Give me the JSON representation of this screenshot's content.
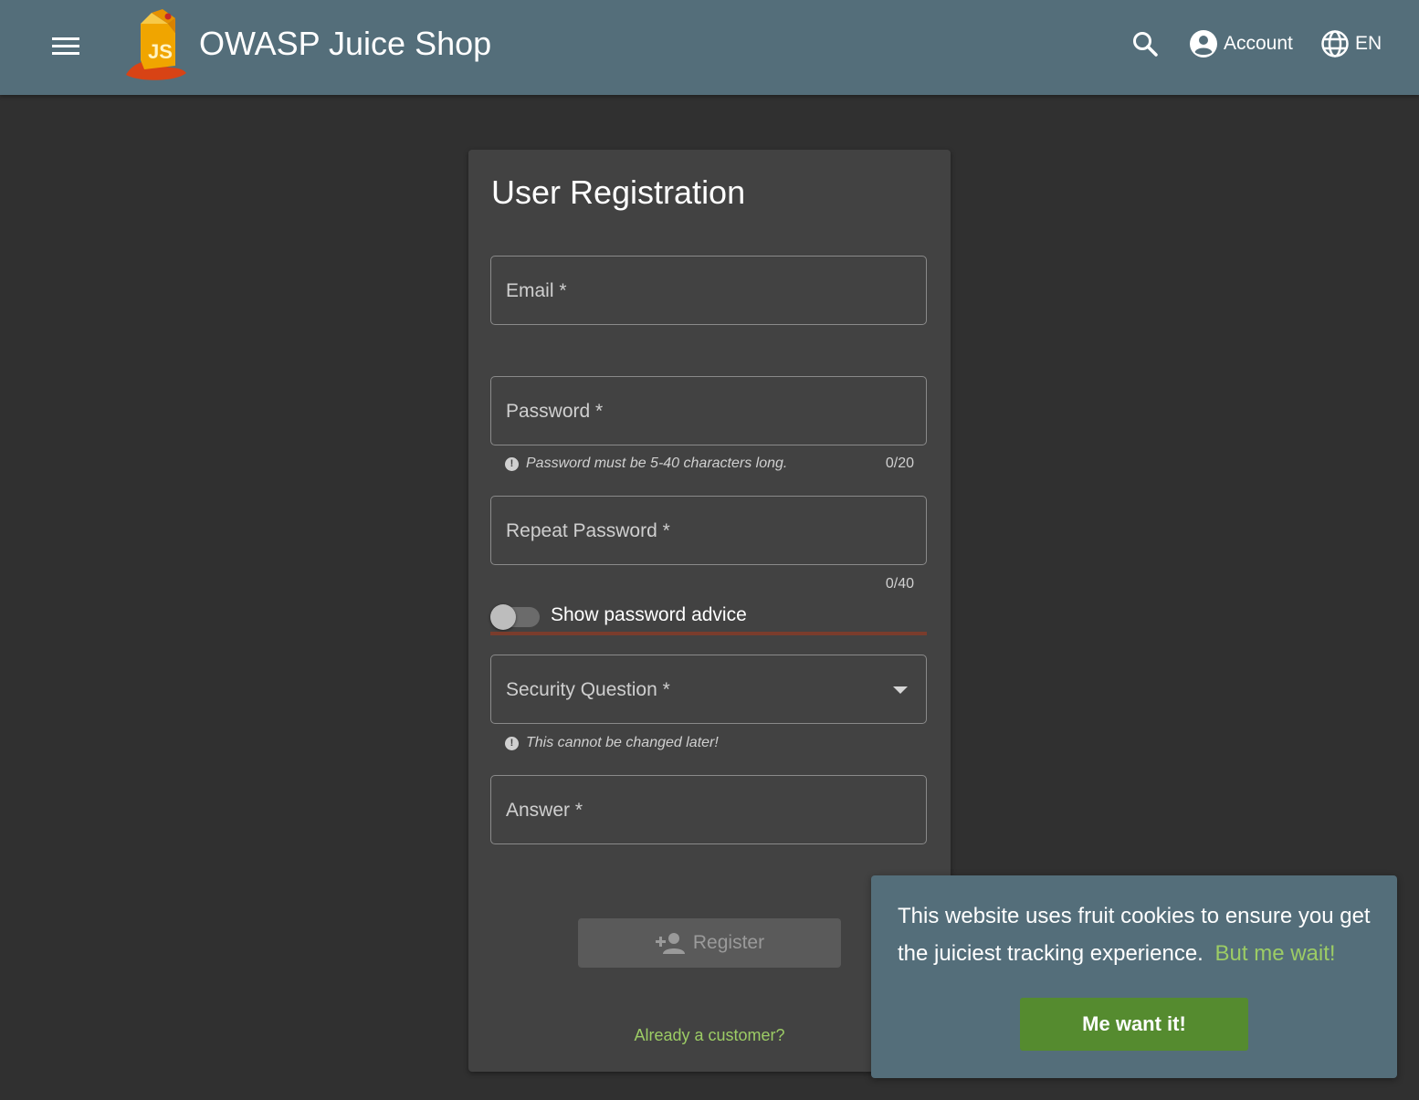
{
  "header": {
    "app_title": "OWASP Juice Shop",
    "account_label": "Account",
    "language_label": "EN",
    "menu_icon": "hamburger-menu-icon",
    "search_icon": "search-icon",
    "account_icon": "account-circle-icon",
    "language_icon": "globe-icon"
  },
  "form": {
    "title": "User Registration",
    "email_label": "Email *",
    "password_label": "Password *",
    "password_hint": "Password must be 5-40 characters long.",
    "password_counter": "0/20",
    "repeat_password_label": "Repeat Password *",
    "repeat_password_counter": "0/40",
    "toggle_label": "Show password advice",
    "toggle_on": false,
    "security_question_label": "Security Question *",
    "security_question_hint": "This cannot be changed later!",
    "answer_label": "Answer *",
    "register_label": "Register",
    "register_icon": "person-add-icon",
    "already_customer_link": "Already a customer?"
  },
  "cookie_banner": {
    "message": "This website uses fruit cookies to ensure you get the juiciest tracking experience.",
    "link_text": "But me wait!",
    "button_label": "Me want it!"
  },
  "colors": {
    "toolbar": "#546e7a",
    "background": "#303030",
    "card": "#424242",
    "accent_green": "#9ccc65",
    "button_green": "#558b2f"
  }
}
